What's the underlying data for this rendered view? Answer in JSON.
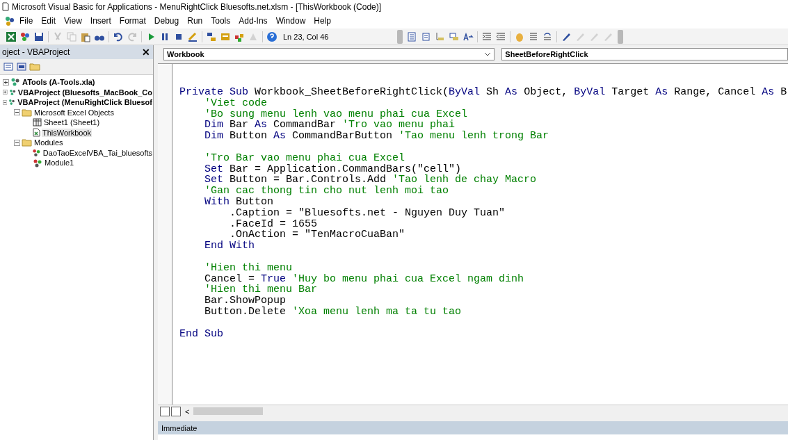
{
  "window": {
    "title": "Microsoft Visual Basic for Applications - MenuRightClick Bluesofts.net.xlsm - [ThisWorkbook (Code)]"
  },
  "menu": [
    "File",
    "Edit",
    "View",
    "Insert",
    "Format",
    "Debug",
    "Run",
    "Tools",
    "Add-Ins",
    "Window",
    "Help"
  ],
  "standard_toolbar": {
    "buttons": [
      {
        "disabled": false
      },
      {
        "disabled": false
      },
      {
        "disabled": false
      },
      {
        "disabled": true
      },
      {
        "disabled": true
      },
      {
        "disabled": false
      },
      {
        "disabled": false
      },
      {
        "disabled": false
      },
      {
        "disabled": true
      },
      {
        "disabled": false
      },
      {
        "disabled": false
      },
      {
        "disabled": false
      },
      {
        "disabled": false
      },
      {
        "disabled": false
      },
      {
        "disabled": false
      },
      {
        "disabled": false
      },
      {
        "disabled": true
      },
      {
        "disabled": false
      }
    ],
    "position": "Ln 23, Col 46"
  },
  "edit_toolbar": {
    "buttons": [
      {
        "disabled": false
      },
      {
        "disabled": false
      },
      {
        "disabled": false
      },
      {
        "disabled": false
      },
      {
        "disabled": false
      },
      {
        "disabled": false
      },
      {
        "disabled": false
      },
      {
        "disabled": false
      },
      {
        "disabled": false
      },
      {
        "disabled": false
      },
      {
        "disabled": false
      },
      {
        "disabled": true
      },
      {
        "disabled": true
      },
      {
        "disabled": true
      }
    ]
  },
  "project_pane": {
    "title": "oject - VBAProject",
    "close": "✕",
    "tree": [
      {
        "kind": "project",
        "label": "ATools (A-Tools.xla)",
        "expanded": false,
        "selected": false
      },
      {
        "kind": "project",
        "label": "VBAProject (Bluesofts_MacBook_Co",
        "expanded": false,
        "selected": false
      },
      {
        "kind": "project",
        "label": "VBAProject (MenuRightClick Bluesof",
        "expanded": true,
        "selected": false,
        "children": [
          {
            "kind": "folder",
            "label": "Microsoft Excel Objects",
            "expanded": true,
            "selected": false,
            "children": [
              {
                "kind": "sheet",
                "label": "Sheet1 (Sheet1)",
                "selected": false
              },
              {
                "kind": "workbook",
                "label": "ThisWorkbook",
                "selected": true
              }
            ]
          },
          {
            "kind": "folder",
            "label": "Modules",
            "expanded": true,
            "selected": false,
            "children": [
              {
                "kind": "module",
                "label": "DaoTaoExcelVBA_Tai_bluesofts",
                "selected": false
              },
              {
                "kind": "module",
                "label": "Module1",
                "selected": false
              }
            ]
          }
        ]
      }
    ]
  },
  "code_window": {
    "object": "Workbook",
    "procedure": "SheetBeforeRightClick",
    "blocks": [
      [
        [
          {
            "kind": "keyword",
            "text": "Private Sub "
          },
          {
            "kind": "code",
            "text": "Workbook_SheetBeforeRightClick("
          },
          {
            "kind": "keyword",
            "text": "ByVal "
          },
          {
            "kind": "code",
            "text": "Sh "
          },
          {
            "kind": "keyword",
            "text": "As "
          },
          {
            "kind": "code",
            "text": "Object, "
          },
          {
            "kind": "keyword",
            "text": "ByVal "
          },
          {
            "kind": "code",
            "text": "Target "
          },
          {
            "kind": "keyword",
            "text": "As "
          },
          {
            "kind": "code",
            "text": "Range, Cancel "
          },
          {
            "kind": "keyword",
            "text": "As "
          },
          {
            "kind": "code",
            "text": "B"
          }
        ],
        [
          {
            "kind": "comment",
            "text": "    'Viet code"
          }
        ],
        [
          {
            "kind": "comment",
            "text": "    'Bo sung menu lenh vao menu phai cua Excel"
          }
        ],
        [
          {
            "kind": "keyword",
            "text": "    Dim "
          },
          {
            "kind": "code",
            "text": "Bar "
          },
          {
            "kind": "keyword",
            "text": "As "
          },
          {
            "kind": "code",
            "text": "CommandBar "
          },
          {
            "kind": "comment",
            "text": "'Tro vao menu phai"
          }
        ],
        [
          {
            "kind": "keyword",
            "text": "    Dim "
          },
          {
            "kind": "code",
            "text": "Button "
          },
          {
            "kind": "keyword",
            "text": "As "
          },
          {
            "kind": "code",
            "text": "CommandBarButton "
          },
          {
            "kind": "comment",
            "text": "'Tao menu lenh trong Bar"
          }
        ]
      ],
      [
        [
          {
            "kind": "comment",
            "text": "    'Tro Bar vao menu phai cua Excel"
          }
        ],
        [
          {
            "kind": "keyword",
            "text": "    Set "
          },
          {
            "kind": "code",
            "text": "Bar = Application.CommandBars(\"cell\")"
          }
        ],
        [
          {
            "kind": "keyword",
            "text": "    Set "
          },
          {
            "kind": "code",
            "text": "Button = Bar.Controls.Add "
          },
          {
            "kind": "comment",
            "text": "'Tao lenh de chay Macro"
          }
        ],
        [
          {
            "kind": "comment",
            "text": "    'Gan cac thong tin cho nut lenh moi tao"
          }
        ],
        [
          {
            "kind": "keyword",
            "text": "    With "
          },
          {
            "kind": "code",
            "text": "Button"
          }
        ],
        [
          {
            "kind": "code",
            "text": "        .Caption = \"Bluesofts.net - Nguyen Duy Tuan\""
          }
        ],
        [
          {
            "kind": "code",
            "text": "        .FaceId = 1655"
          }
        ],
        [
          {
            "kind": "code",
            "text": "        .OnAction = \"TenMacroCuaBan\""
          }
        ],
        [
          {
            "kind": "keyword",
            "text": "    End With"
          }
        ]
      ],
      [
        [
          {
            "kind": "comment",
            "text": "    'Hien thi menu"
          }
        ],
        [
          {
            "kind": "code",
            "text": "    Cancel = "
          },
          {
            "kind": "keyword",
            "text": "True "
          },
          {
            "kind": "comment",
            "text": "'Huy bo menu phai cua Excel ngam dinh"
          }
        ],
        [
          {
            "kind": "comment",
            "text": "    'Hien thi menu Bar"
          }
        ],
        [
          {
            "kind": "code",
            "text": "    Bar.ShowPopup"
          }
        ],
        [
          {
            "kind": "code",
            "text": "    Button.Delete "
          },
          {
            "kind": "comment",
            "text": "'Xoa menu lenh ma ta tu tao"
          }
        ]
      ],
      [
        [
          {
            "kind": "keyword",
            "text": "End Sub"
          }
        ]
      ]
    ]
  },
  "scroll_left": "<",
  "immediate": {
    "title": "Immediate"
  }
}
